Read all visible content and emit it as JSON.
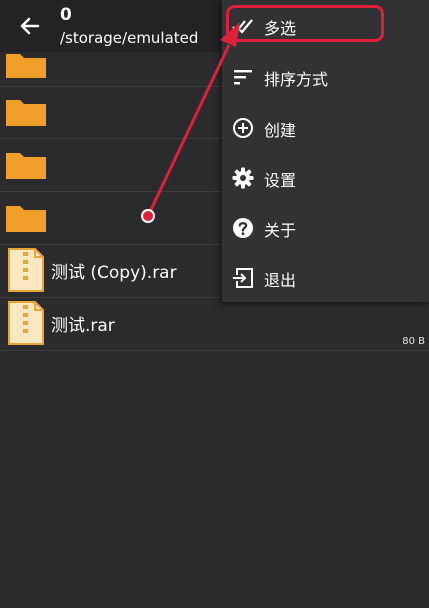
{
  "header": {
    "back_icon": "arrow-left-icon",
    "count": "0",
    "path": "/storage/emulated"
  },
  "files": [
    {
      "type": "folder",
      "name": "",
      "size": ""
    },
    {
      "type": "folder",
      "name": "",
      "size": ""
    },
    {
      "type": "folder",
      "name": "",
      "size": ""
    },
    {
      "type": "folder",
      "name": "",
      "size": ""
    },
    {
      "type": "archive",
      "name": "测试 (Copy).rar",
      "size": ""
    },
    {
      "type": "archive",
      "name": "测试.rar",
      "size": "80 B"
    }
  ],
  "menu": {
    "items": [
      {
        "label": "多选",
        "icon": "check-multiple-icon"
      },
      {
        "label": "排序方式",
        "icon": "sort-icon"
      },
      {
        "label": "创建",
        "icon": "add-circle-icon"
      },
      {
        "label": "设置",
        "icon": "gear-icon"
      },
      {
        "label": "关于",
        "icon": "help-circle-icon"
      },
      {
        "label": "退出",
        "icon": "exit-icon"
      }
    ]
  },
  "colors": {
    "background": "#2b2b2d",
    "appbar": "#232325",
    "menu": "#323234",
    "folder": "#f0a02a",
    "annotation": "#e0203a"
  }
}
